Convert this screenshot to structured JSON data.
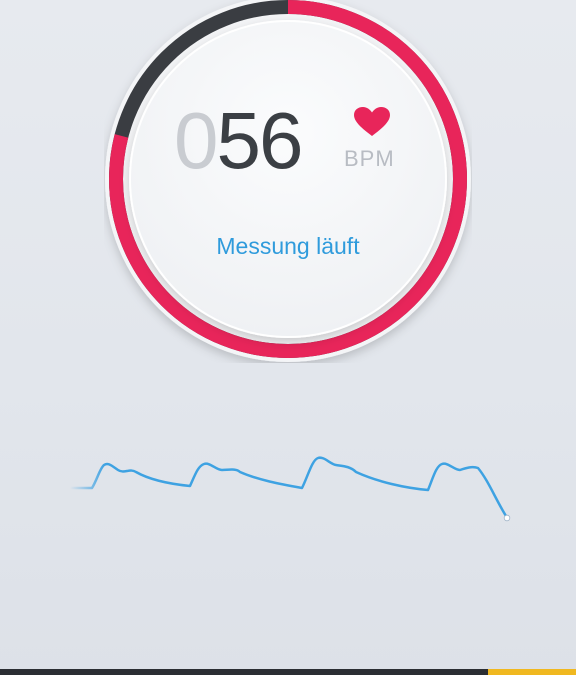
{
  "measurement": {
    "value_lead": "0",
    "value_main": "56",
    "unit": "BPM",
    "status": "Messung läuft",
    "progress_fraction": 0.79
  },
  "colors": {
    "ring_progress": "#e8255a",
    "ring_track": "#3a3d42",
    "status_text": "#2f9bdc",
    "waveform": "#3ea2e2",
    "heart": "#e8255a"
  },
  "icons": {
    "heart": "heart-icon"
  }
}
